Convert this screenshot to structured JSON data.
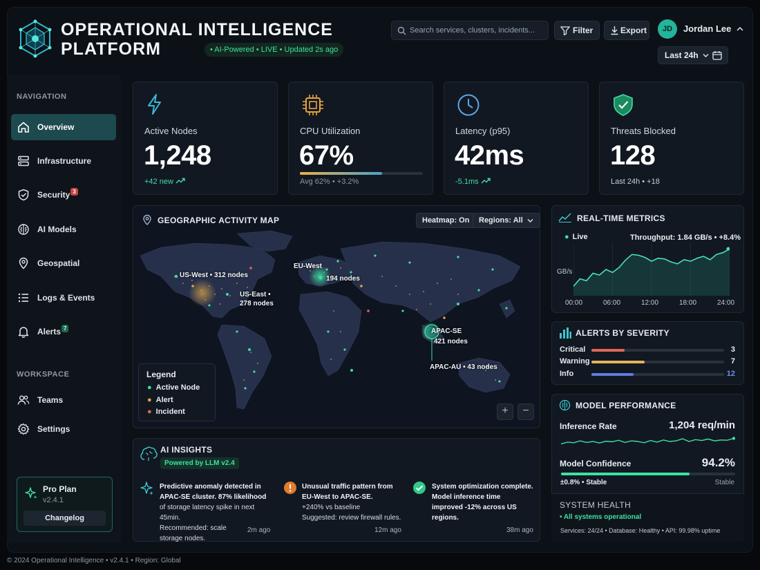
{
  "header": {
    "title_line1": "OPERATIONAL INTELLIGENCE",
    "title_line2": "PLATFORM",
    "status": "• AI-Powered • LIVE • Updated 2s ago",
    "search_placeholder": "Search services, clusters, incidents...",
    "filter_label": "Filter",
    "export_label": "Export",
    "user_initials": "JD",
    "user_name": "Jordan Lee",
    "time_range": "Last 24h"
  },
  "sidebar": {
    "nav_heading": "NAVIGATION",
    "items": [
      {
        "label": "Overview",
        "icon": "home-icon"
      },
      {
        "label": "Infrastructure",
        "icon": "server-icon"
      },
      {
        "label": "Security",
        "icon": "shield-icon",
        "badge": "3"
      },
      {
        "label": "AI Models",
        "icon": "brain-icon"
      },
      {
        "label": "Geospatial",
        "icon": "map-pin-icon"
      },
      {
        "label": "Logs & Events",
        "icon": "list-icon"
      },
      {
        "label": "Alerts",
        "icon": "bell-icon",
        "badge": "7"
      }
    ],
    "workspace_heading": "WORKSPACE",
    "workspace_items": [
      {
        "label": "Teams",
        "icon": "users-icon"
      },
      {
        "label": "Settings",
        "icon": "gear-icon"
      }
    ],
    "plan": {
      "name": "Pro Plan",
      "version": "v2.4.1",
      "button": "Changelog"
    }
  },
  "kpis": [
    {
      "label": "Active Nodes",
      "value": "1,248",
      "sub": "+42 new",
      "icon": "lightning-icon"
    },
    {
      "label": "CPU Utilization",
      "value": "67%",
      "sub": "Avg 62% • +3.2%",
      "icon": "chip-icon",
      "progress": 0.67
    },
    {
      "label": "Latency (p95)",
      "value": "42ms",
      "sub": "-5.1ms",
      "icon": "clock-icon"
    },
    {
      "label": "Threats Blocked",
      "value": "128",
      "sub": "Last 24h • +18",
      "icon": "shield-check-icon"
    }
  ],
  "map": {
    "title": "GEOGRAPHIC ACTIVITY MAP",
    "heatmap_chip": "Heatmap: On",
    "regions_chip": "Regions: All",
    "regions": [
      {
        "name": "US-West",
        "label": "US-West • 312 nodes"
      },
      {
        "name": "US-East",
        "label": "US-East •",
        "label2": "278 nodes"
      },
      {
        "name": "EU-West",
        "label": "EU-West",
        "label2": "194 nodes"
      },
      {
        "name": "APAC-SE",
        "label": "APAC-SE",
        "label2": "421 nodes"
      },
      {
        "name": "APAC-AU",
        "label": "APAC-AU • 43 nodes"
      }
    ],
    "legend": {
      "title": "Legend",
      "items": [
        "Active Node",
        "Alert",
        "Incident"
      ]
    },
    "zoom_in": "+",
    "zoom_out": "−"
  },
  "insights": {
    "title": "AI INSIGHTS",
    "powered": "Powered by LLM v2.4",
    "items": [
      {
        "line1": "Predictive anomaly detected in",
        "line2": "APAC-SE cluster. 87% likelihood",
        "line3": "of storage latency spike in next 45min.",
        "line4": "Recommended: scale",
        "line5": "storage nodes.",
        "ago": "2m ago"
      },
      {
        "line1": "Unusual traffic pattern from",
        "line2": "EU-West to APAC-SE.",
        "line3": "+240% vs baseline",
        "line4": "Suggested: review firewall rules.",
        "ago": "12m ago"
      },
      {
        "line1": "System optimization complete.",
        "line2": "Model inference time",
        "line3": "improved -12% across US",
        "line4": "regions.",
        "ago": "38m ago"
      }
    ]
  },
  "realtime": {
    "title": "REAL-TIME METRICS",
    "live": "Live",
    "throughput": "Throughput: 1.84 GB/s • +8.4%",
    "ylabel": "GB/s",
    "xticks": [
      "00:00",
      "06:00",
      "12:00",
      "18:00",
      "24:00"
    ]
  },
  "chart_data": {
    "type": "line",
    "x": [
      "00:00",
      "01:00",
      "02:00",
      "03:00",
      "04:00",
      "05:00",
      "06:00",
      "07:00",
      "08:00",
      "09:00",
      "10:00",
      "11:00",
      "12:00",
      "13:00",
      "14:00",
      "15:00",
      "16:00",
      "17:00",
      "18:00",
      "19:00",
      "20:00",
      "21:00",
      "22:00",
      "23:00",
      "24:00"
    ],
    "values": [
      1.05,
      1.25,
      1.2,
      1.4,
      1.35,
      1.5,
      1.42,
      1.55,
      1.75,
      1.9,
      1.88,
      1.82,
      1.72,
      1.8,
      1.78,
      1.7,
      1.65,
      1.76,
      1.72,
      1.8,
      1.85,
      1.76,
      1.9,
      1.95,
      2.05
    ],
    "ylim": [
      0.8,
      2.2
    ],
    "ylabel": "GB/s",
    "title": "REAL-TIME METRICS"
  },
  "alerts": {
    "title": "ALERTS BY SEVERITY",
    "rows": [
      {
        "label": "Critical",
        "count": "3",
        "fraction": 0.25,
        "color": "#e2675c"
      },
      {
        "label": "Warning",
        "count": "7",
        "fraction": 0.4,
        "color": "#e6b35a"
      },
      {
        "label": "Info",
        "count": "12",
        "fraction": 0.32,
        "color": "#5d7de0"
      }
    ]
  },
  "model": {
    "title": "MODEL PERFORMANCE",
    "inference_label": "Inference Rate",
    "inference_value": "1,204 req/min",
    "inference_series": [
      0.3,
      0.45,
      0.4,
      0.55,
      0.42,
      0.5,
      0.38,
      0.52,
      0.48,
      0.6,
      0.42,
      0.55,
      0.5,
      0.4,
      0.58,
      0.45,
      0.62,
      0.5,
      0.55,
      0.72,
      0.5,
      0.65,
      0.58,
      0.7,
      0.55,
      0.62,
      0.6,
      0.75
    ],
    "confidence_label": "Model Confidence",
    "confidence_value": "94.2%",
    "confidence_fraction": 0.74,
    "stability": "±0.8% • Stable",
    "stable": "Stable"
  },
  "health": {
    "title": "SYSTEM HEALTH",
    "status": "• All systems operational",
    "details": "Services: 24/24 • Database: Healthy • API: 99.98% uptime"
  },
  "footer": "© 2024 Operational Intelligence • v2.4.1 • Region: Global",
  "colors": {
    "accent": "#3ee0a4",
    "teal": "#1d4a4e",
    "alert": "#e6a04a",
    "incident": "#e2675c"
  }
}
